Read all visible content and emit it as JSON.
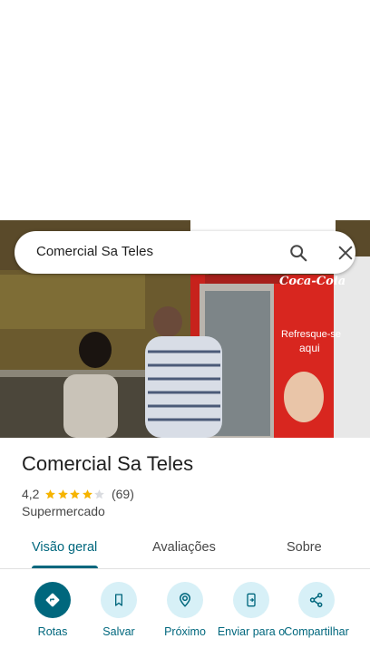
{
  "search": {
    "query": "Comercial Sa Teles"
  },
  "place": {
    "name": "Comercial Sa Teles",
    "rating": "4,2",
    "stars": 4.2,
    "review_count": "(69)",
    "category": "Supermercado"
  },
  "tabs": [
    {
      "label": "Visão geral",
      "active": true
    },
    {
      "label": "Avaliações",
      "active": false
    },
    {
      "label": "Sobre",
      "active": false
    }
  ],
  "actions": [
    {
      "label": "Rotas",
      "icon": "directions-icon"
    },
    {
      "label": "Salvar",
      "icon": "bookmark-icon"
    },
    {
      "label": "Próximo",
      "icon": "nearby-icon"
    },
    {
      "label": "Enviar para o",
      "icon": "send-to-phone-icon"
    },
    {
      "label": "Compartilhar",
      "icon": "share-icon"
    }
  ],
  "colors": {
    "accent": "#00677d",
    "action_bg": "#d7f0f7",
    "star": "#f6b400",
    "star_empty": "#dadce0"
  },
  "photo": {
    "sign_text": "Coca-Cola",
    "fridge_slogan_1": "Refresque-se",
    "fridge_slogan_2": "aqui"
  }
}
